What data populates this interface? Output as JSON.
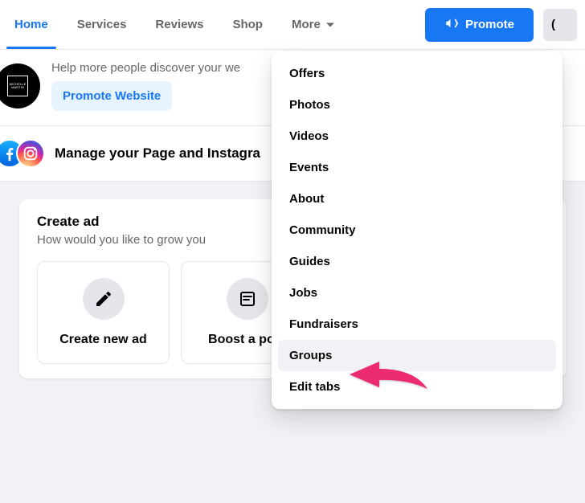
{
  "nav": {
    "tabs": [
      {
        "label": "Home",
        "active": true
      },
      {
        "label": "Services"
      },
      {
        "label": "Reviews"
      },
      {
        "label": "Shop"
      },
      {
        "label": "More",
        "caret": true
      }
    ],
    "promote_button": "Promote"
  },
  "promo": {
    "avatar_label": "MICHELLE MARTIN",
    "help_text": "Help more people discover your we",
    "cta": "Promote Website"
  },
  "manage": {
    "text": "Manage your Page and Instagra"
  },
  "create_ad": {
    "title": "Create ad",
    "subtitle": "How would you like to grow you",
    "options": [
      {
        "label": "Create new ad",
        "icon": "edit"
      },
      {
        "label": "Boost a post",
        "icon": "post"
      }
    ]
  },
  "dropdown": {
    "items": [
      "Offers",
      "Photos",
      "Videos",
      "Events",
      "About",
      "Community",
      "Guides",
      "Jobs",
      "Fundraisers",
      "Groups",
      "Edit tabs"
    ],
    "highlighted_index": 9
  },
  "annotation": {
    "target": "Groups"
  }
}
